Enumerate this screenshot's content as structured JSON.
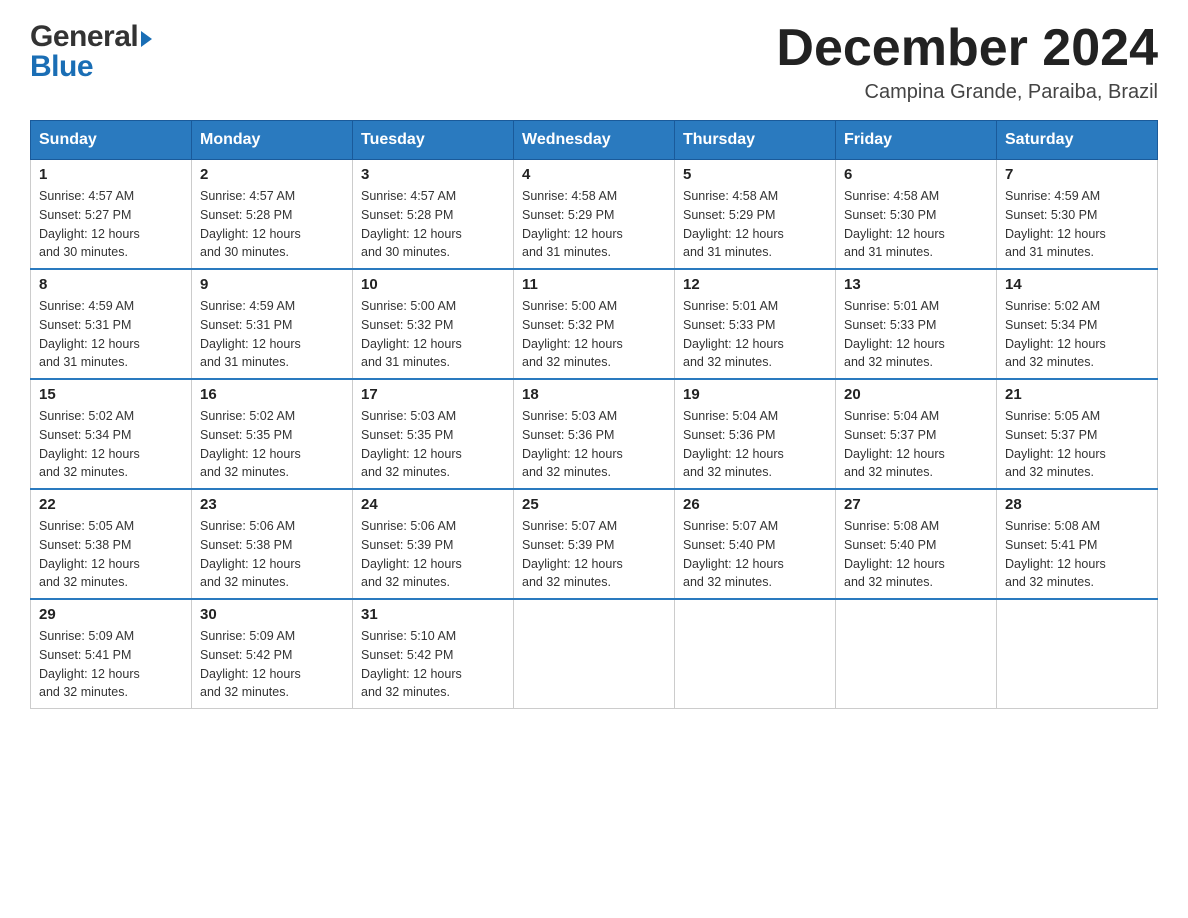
{
  "header": {
    "logo_general": "General",
    "logo_blue": "Blue",
    "month_title": "December 2024",
    "location": "Campina Grande, Paraiba, Brazil"
  },
  "weekdays": [
    "Sunday",
    "Monday",
    "Tuesday",
    "Wednesday",
    "Thursday",
    "Friday",
    "Saturday"
  ],
  "weeks": [
    [
      {
        "day": "1",
        "sunrise": "4:57 AM",
        "sunset": "5:27 PM",
        "daylight": "12 hours and 30 minutes."
      },
      {
        "day": "2",
        "sunrise": "4:57 AM",
        "sunset": "5:28 PM",
        "daylight": "12 hours and 30 minutes."
      },
      {
        "day": "3",
        "sunrise": "4:57 AM",
        "sunset": "5:28 PM",
        "daylight": "12 hours and 30 minutes."
      },
      {
        "day": "4",
        "sunrise": "4:58 AM",
        "sunset": "5:29 PM",
        "daylight": "12 hours and 31 minutes."
      },
      {
        "day": "5",
        "sunrise": "4:58 AM",
        "sunset": "5:29 PM",
        "daylight": "12 hours and 31 minutes."
      },
      {
        "day": "6",
        "sunrise": "4:58 AM",
        "sunset": "5:30 PM",
        "daylight": "12 hours and 31 minutes."
      },
      {
        "day": "7",
        "sunrise": "4:59 AM",
        "sunset": "5:30 PM",
        "daylight": "12 hours and 31 minutes."
      }
    ],
    [
      {
        "day": "8",
        "sunrise": "4:59 AM",
        "sunset": "5:31 PM",
        "daylight": "12 hours and 31 minutes."
      },
      {
        "day": "9",
        "sunrise": "4:59 AM",
        "sunset": "5:31 PM",
        "daylight": "12 hours and 31 minutes."
      },
      {
        "day": "10",
        "sunrise": "5:00 AM",
        "sunset": "5:32 PM",
        "daylight": "12 hours and 31 minutes."
      },
      {
        "day": "11",
        "sunrise": "5:00 AM",
        "sunset": "5:32 PM",
        "daylight": "12 hours and 32 minutes."
      },
      {
        "day": "12",
        "sunrise": "5:01 AM",
        "sunset": "5:33 PM",
        "daylight": "12 hours and 32 minutes."
      },
      {
        "day": "13",
        "sunrise": "5:01 AM",
        "sunset": "5:33 PM",
        "daylight": "12 hours and 32 minutes."
      },
      {
        "day": "14",
        "sunrise": "5:02 AM",
        "sunset": "5:34 PM",
        "daylight": "12 hours and 32 minutes."
      }
    ],
    [
      {
        "day": "15",
        "sunrise": "5:02 AM",
        "sunset": "5:34 PM",
        "daylight": "12 hours and 32 minutes."
      },
      {
        "day": "16",
        "sunrise": "5:02 AM",
        "sunset": "5:35 PM",
        "daylight": "12 hours and 32 minutes."
      },
      {
        "day": "17",
        "sunrise": "5:03 AM",
        "sunset": "5:35 PM",
        "daylight": "12 hours and 32 minutes."
      },
      {
        "day": "18",
        "sunrise": "5:03 AM",
        "sunset": "5:36 PM",
        "daylight": "12 hours and 32 minutes."
      },
      {
        "day": "19",
        "sunrise": "5:04 AM",
        "sunset": "5:36 PM",
        "daylight": "12 hours and 32 minutes."
      },
      {
        "day": "20",
        "sunrise": "5:04 AM",
        "sunset": "5:37 PM",
        "daylight": "12 hours and 32 minutes."
      },
      {
        "day": "21",
        "sunrise": "5:05 AM",
        "sunset": "5:37 PM",
        "daylight": "12 hours and 32 minutes."
      }
    ],
    [
      {
        "day": "22",
        "sunrise": "5:05 AM",
        "sunset": "5:38 PM",
        "daylight": "12 hours and 32 minutes."
      },
      {
        "day": "23",
        "sunrise": "5:06 AM",
        "sunset": "5:38 PM",
        "daylight": "12 hours and 32 minutes."
      },
      {
        "day": "24",
        "sunrise": "5:06 AM",
        "sunset": "5:39 PM",
        "daylight": "12 hours and 32 minutes."
      },
      {
        "day": "25",
        "sunrise": "5:07 AM",
        "sunset": "5:39 PM",
        "daylight": "12 hours and 32 minutes."
      },
      {
        "day": "26",
        "sunrise": "5:07 AM",
        "sunset": "5:40 PM",
        "daylight": "12 hours and 32 minutes."
      },
      {
        "day": "27",
        "sunrise": "5:08 AM",
        "sunset": "5:40 PM",
        "daylight": "12 hours and 32 minutes."
      },
      {
        "day": "28",
        "sunrise": "5:08 AM",
        "sunset": "5:41 PM",
        "daylight": "12 hours and 32 minutes."
      }
    ],
    [
      {
        "day": "29",
        "sunrise": "5:09 AM",
        "sunset": "5:41 PM",
        "daylight": "12 hours and 32 minutes."
      },
      {
        "day": "30",
        "sunrise": "5:09 AM",
        "sunset": "5:42 PM",
        "daylight": "12 hours and 32 minutes."
      },
      {
        "day": "31",
        "sunrise": "5:10 AM",
        "sunset": "5:42 PM",
        "daylight": "12 hours and 32 minutes."
      },
      null,
      null,
      null,
      null
    ]
  ],
  "labels": {
    "sunrise": "Sunrise:",
    "sunset": "Sunset:",
    "daylight": "Daylight:"
  }
}
